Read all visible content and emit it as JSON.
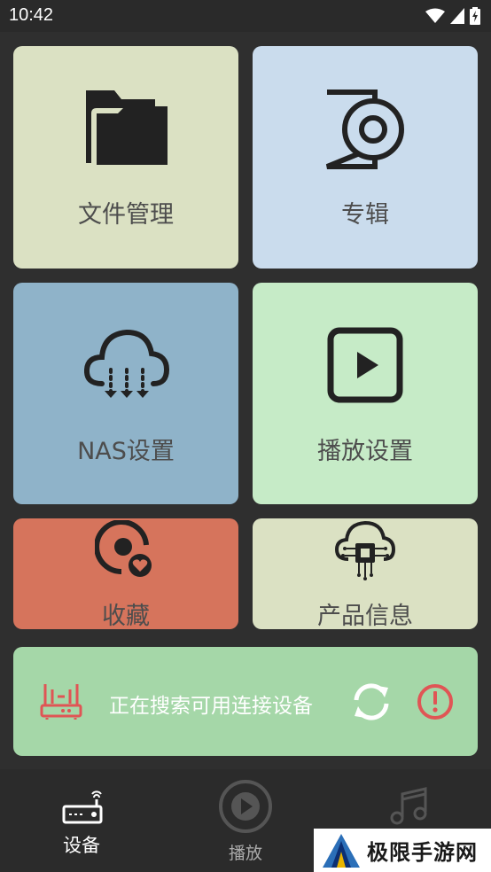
{
  "status_bar": {
    "time": "10:42"
  },
  "tiles": {
    "files": {
      "label": "文件管理",
      "icon": "folder-icon",
      "color": "#dbe1c3"
    },
    "album": {
      "label": "专辑",
      "icon": "album-disc-icon",
      "color": "#cadced"
    },
    "nas": {
      "label": "NAS设置",
      "icon": "cloud-download-icon",
      "color": "#8fb3c9"
    },
    "playset": {
      "label": "播放设置",
      "icon": "play-square-icon",
      "color": "#c6ebc7"
    },
    "fav": {
      "label": "收藏",
      "icon": "favorite-disc-icon",
      "color": "#d6745c"
    },
    "product": {
      "label": "产品信息",
      "icon": "cloud-chip-icon",
      "color": "#dbe1c3"
    }
  },
  "search": {
    "text": "正在搜索可用连接设备",
    "icons": [
      "router-icon",
      "refresh-icon",
      "alert-icon"
    ],
    "color": "#a5d7a8",
    "alert_color": "#e05555"
  },
  "bottom_nav": {
    "items": [
      {
        "label": "设备",
        "icon": "router-wifi-icon",
        "active": true
      },
      {
        "label": "播放",
        "icon": "play-circle-icon",
        "active": false
      },
      {
        "label": "",
        "icon": "music-note-icon",
        "active": false
      }
    ]
  },
  "watermark": {
    "text": "极限手游网"
  }
}
